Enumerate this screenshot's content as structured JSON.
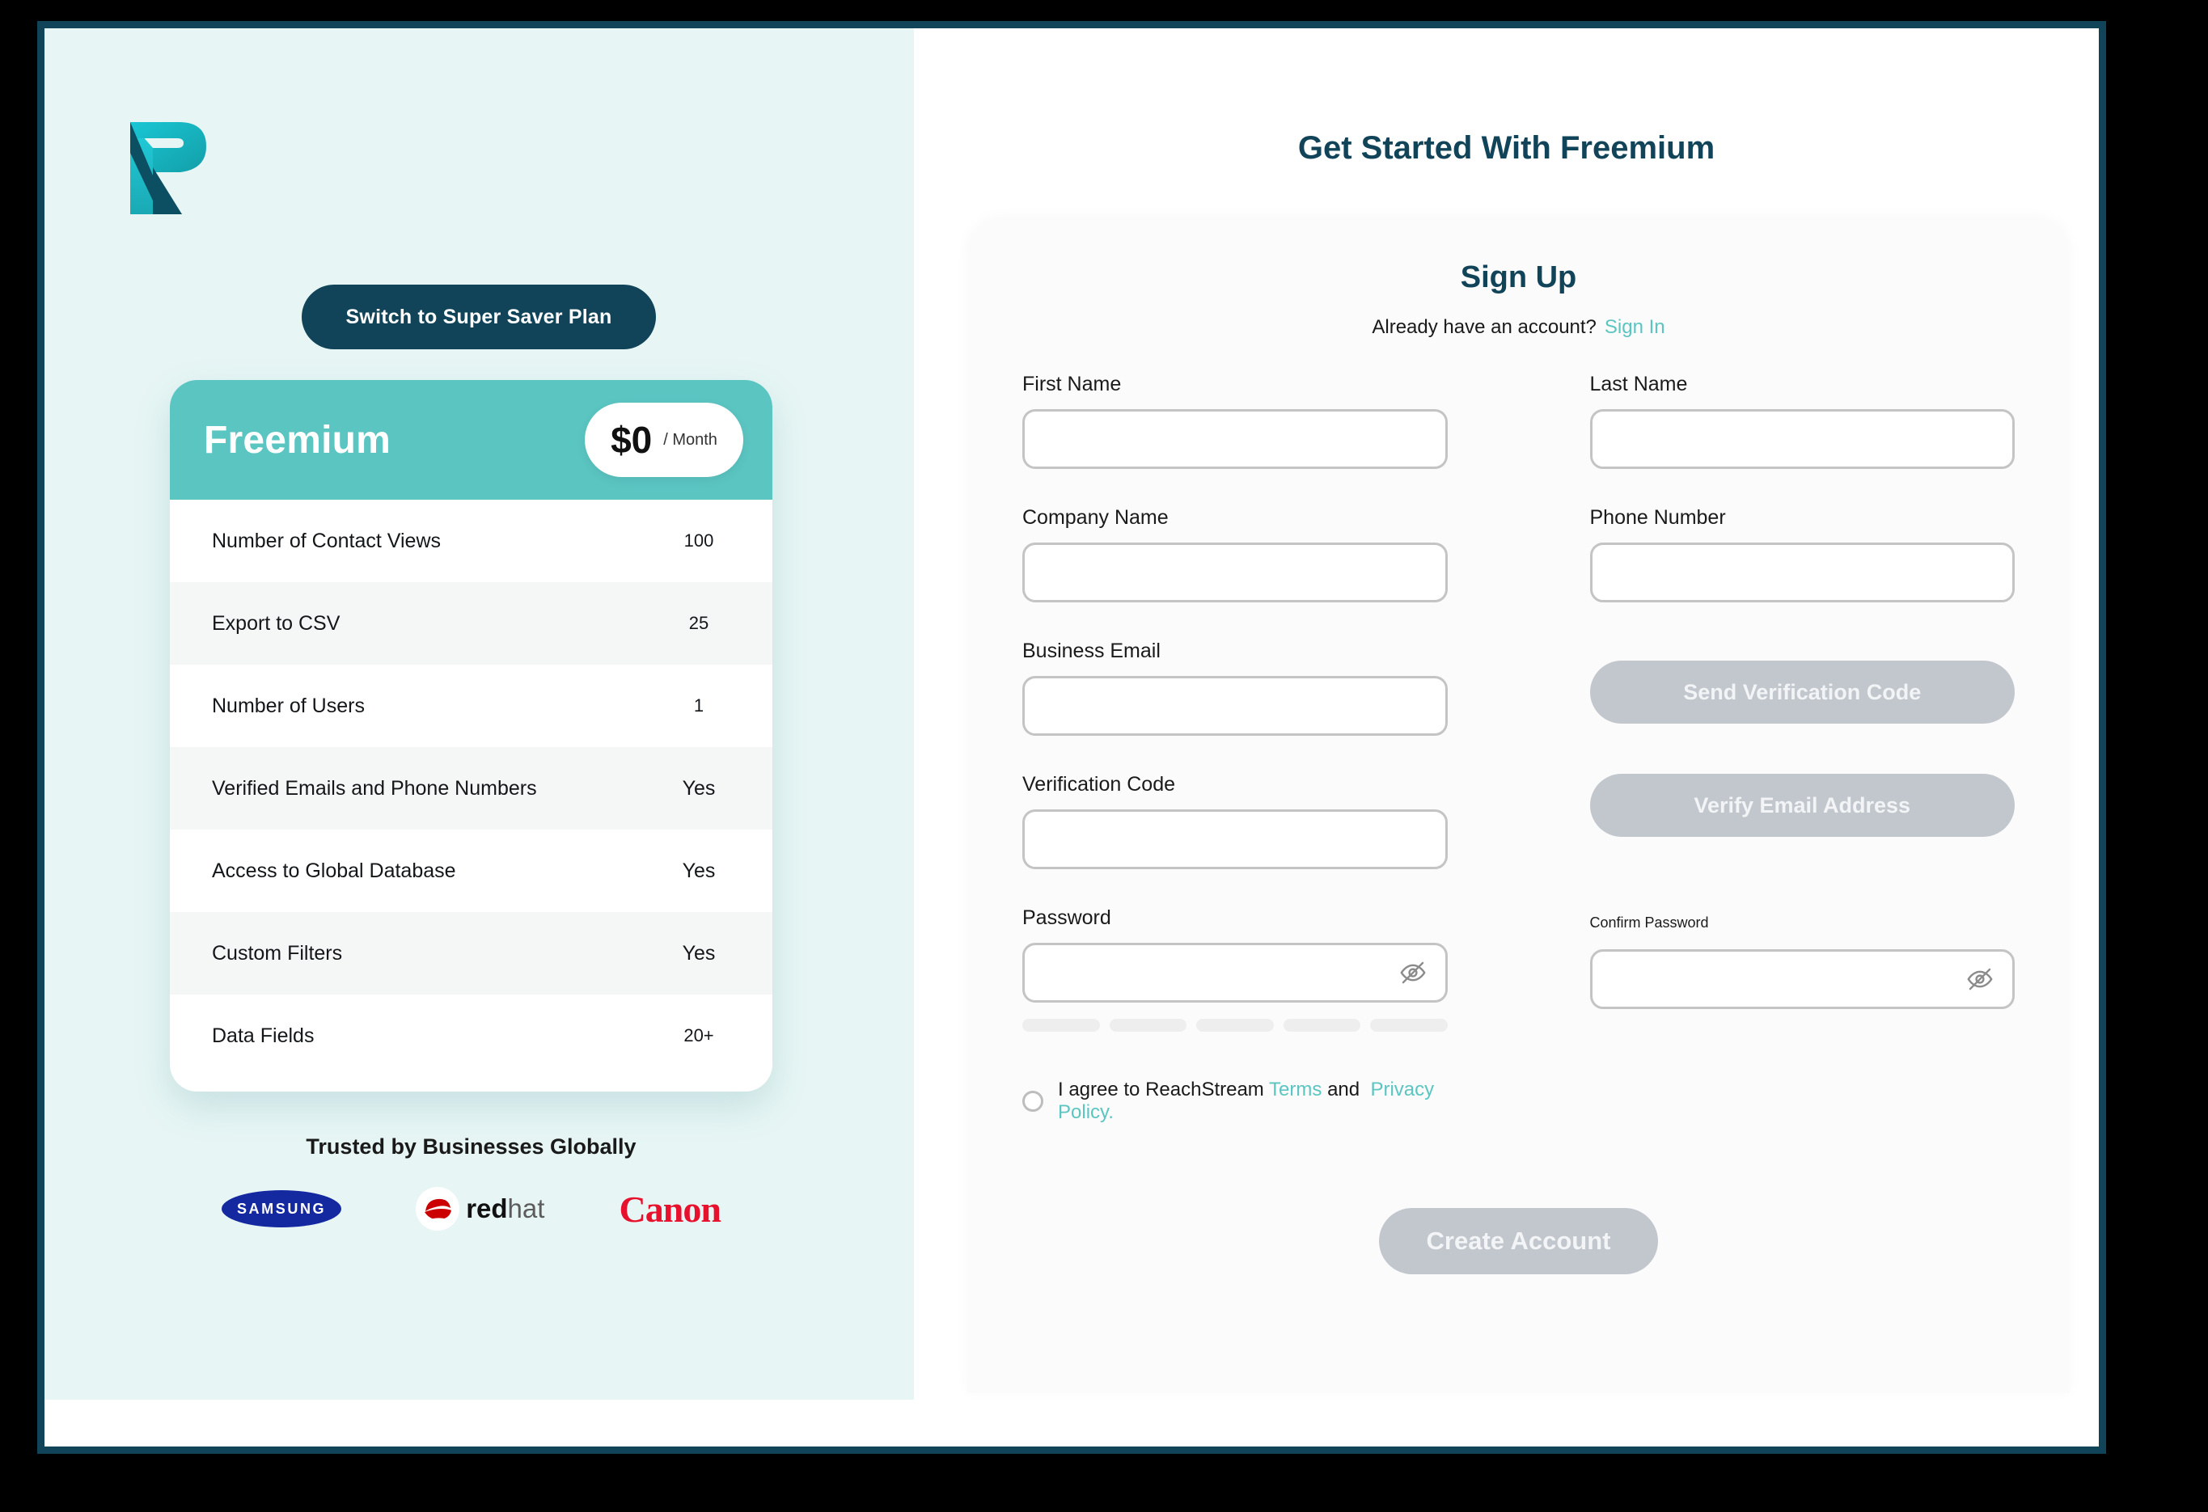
{
  "left": {
    "logo_name": "reachstream-logo",
    "switch_plan_label": "Switch to Super Saver Plan",
    "plan": {
      "name": "Freemium",
      "price": "$0",
      "period": "/ Month",
      "features": [
        {
          "label": "Number of Contact Views",
          "value": "100"
        },
        {
          "label": "Export to CSV",
          "value": "25"
        },
        {
          "label": "Number of Users",
          "value": "1"
        },
        {
          "label": "Verified Emails and Phone Numbers",
          "value": "Yes"
        },
        {
          "label": "Access to Global Database",
          "value": "Yes"
        },
        {
          "label": "Custom Filters",
          "value": "Yes"
        },
        {
          "label": "Data Fields",
          "value": "20+"
        }
      ]
    },
    "trusted": {
      "title": "Trusted by Businesses Globally",
      "logos": [
        {
          "name": "samsung-logo",
          "text": "SAMSUNG"
        },
        {
          "name": "redhat-logo",
          "text": "red",
          "text_light": "hat"
        },
        {
          "name": "canon-logo",
          "text": "Canon"
        }
      ]
    }
  },
  "right": {
    "page_title": "Get Started With Freemium",
    "signup_heading": "Sign Up",
    "already_account_text": "Already have an account?",
    "sign_in_label": "Sign In",
    "fields": {
      "first_name_label": "First Name",
      "first_name_value": "",
      "last_name_label": "Last Name",
      "last_name_value": "",
      "company_name_label": "Company Name",
      "company_name_value": "",
      "phone_number_label": "Phone Number",
      "phone_number_value": "",
      "business_email_label": "Business Email",
      "business_email_value": "",
      "verification_code_label": "Verification Code",
      "verification_code_value": "",
      "password_label": "Password",
      "password_value": "",
      "confirm_password_label": "Confirm Password",
      "confirm_password_value": ""
    },
    "buttons": {
      "send_verification_code": "Send Verification Code",
      "verify_email_address": "Verify Email Address",
      "create_account": "Create Account"
    },
    "terms": {
      "prefix": "I agree to ReachStream",
      "terms_label": "Terms",
      "conjunction": "and",
      "privacy_label": "Privacy Policy."
    },
    "password_strength_segments": 5
  },
  "colors": {
    "frame_border": "#114459",
    "left_bg": "#e7f6f5",
    "brand_teal": "#5bc5c2",
    "brand_navy": "#124459",
    "disabled_button": "#c2c7ce",
    "input_border": "#c4c4c4"
  }
}
